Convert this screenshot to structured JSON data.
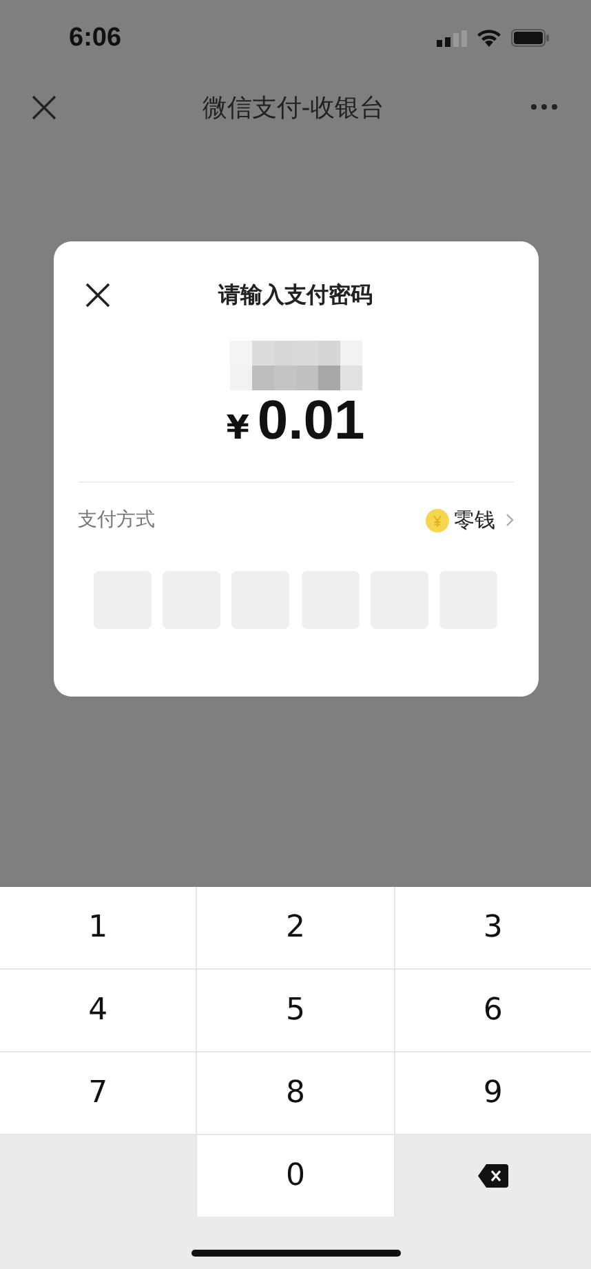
{
  "status_bar": {
    "time": "6:06"
  },
  "nav_bar": {
    "title": "微信支付-收银台"
  },
  "dialog": {
    "title": "请输入支付密码",
    "currency": "¥",
    "amount": "0.01",
    "method_label": "支付方式",
    "method_value": "零钱",
    "pin_boxes": [
      {
        "filled": false
      },
      {
        "filled": false
      },
      {
        "filled": false
      },
      {
        "filled": false
      },
      {
        "filled": false
      },
      {
        "filled": false
      }
    ]
  },
  "keypad": [
    {
      "kind": "digit",
      "label": "1"
    },
    {
      "kind": "digit",
      "label": "2"
    },
    {
      "kind": "digit",
      "label": "3"
    },
    {
      "kind": "digit",
      "label": "4"
    },
    {
      "kind": "digit",
      "label": "5"
    },
    {
      "kind": "digit",
      "label": "6"
    },
    {
      "kind": "digit",
      "label": "7"
    },
    {
      "kind": "digit",
      "label": "8"
    },
    {
      "kind": "digit",
      "label": "9"
    },
    {
      "kind": "blank"
    },
    {
      "kind": "digit",
      "label": "0"
    },
    {
      "kind": "delete"
    }
  ]
}
